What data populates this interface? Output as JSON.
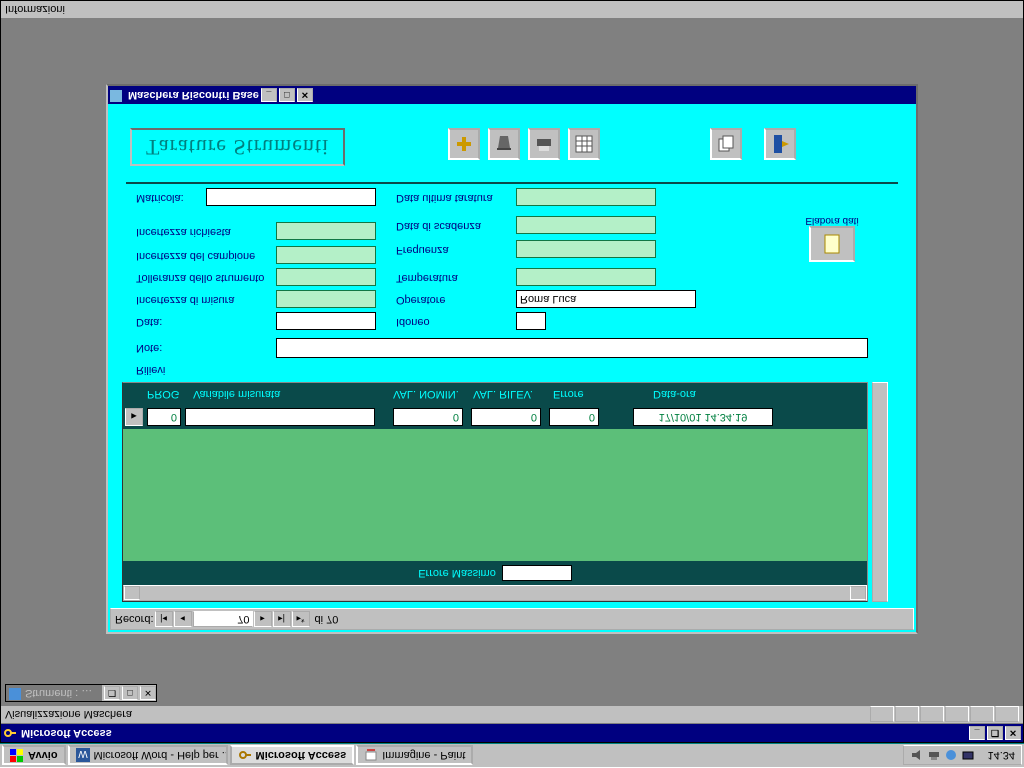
{
  "taskbar": {
    "start": "Avvio",
    "items": [
      {
        "label": "Microsoft Word - Help per ..."
      },
      {
        "label": "Microsoft Access"
      },
      {
        "label": "Immagine - Paint"
      }
    ],
    "clock": "14.34"
  },
  "app": {
    "title": "Microsoft Access",
    "status_top": "Visualizzazione Maschera",
    "status_bottom": "Informazioni",
    "minimized": "Strumenti : …"
  },
  "form": {
    "title": "Maschera Riscontri Base",
    "record_nav": {
      "label": "Record:",
      "current": "70",
      "of": "di 70"
    },
    "heading": "Tarature Strumenti",
    "rilievi": "Rilievi",
    "columns": {
      "prog": "PROG",
      "var": "Variabile misurata",
      "valnom": "VAL. NOMIN.",
      "valril": "VAL. RILEV.",
      "errore": "Errore",
      "dataora": "Data-ora"
    },
    "row": {
      "prog": "0",
      "valnom": "0",
      "valril": "0",
      "errore": "0",
      "dataora": "17/10/01 14.34.19"
    },
    "errmax_label": "Errore Massimo",
    "labels": {
      "note": "Note:",
      "data": "Data:",
      "incmis": "Incertezza di misura",
      "tolstr": "Tolleranza dello strumento",
      "inccamp": "Incertezza del campione",
      "increq": "Incertezza richiesta",
      "matricola": "Matricola:",
      "idoneo": "Idoneo",
      "operatore": "Operatore",
      "temperatura": "Temperatura",
      "frequenza": "Frequenza",
      "datascad": "Data di scadenza",
      "dataulttar": "Data ultima taratura"
    },
    "values": {
      "operatore": "Roma Luca"
    },
    "elabora": "Elabora dati"
  }
}
